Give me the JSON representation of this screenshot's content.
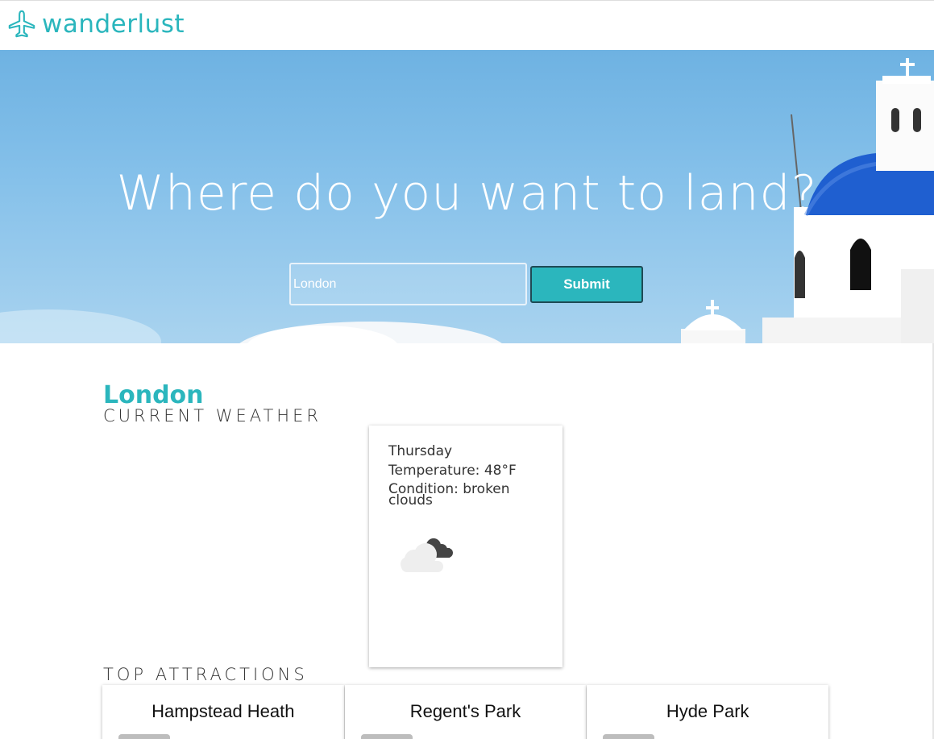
{
  "app": {
    "brand": "wanderlust"
  },
  "hero": {
    "title": "Where do you want to land?",
    "search": {
      "value": "London",
      "placeholder": "London"
    },
    "submit_label": "Submit"
  },
  "city": {
    "name": "London"
  },
  "weather": {
    "heading": "CURRENT WEATHER",
    "day": "Thursday",
    "temperature": "Temperature: 48°F",
    "condition": "Condition: broken clouds",
    "icon": "broken-clouds-icon"
  },
  "attractions": {
    "heading": "TOP ATTRACTIONS",
    "items": [
      {
        "name": "Hampstead Heath"
      },
      {
        "name": "Regent's Park"
      },
      {
        "name": "Hyde Park"
      }
    ]
  },
  "colors": {
    "accent": "#2bb6bd",
    "sky": "#86c1ea",
    "dome": "#1f5fd0"
  }
}
